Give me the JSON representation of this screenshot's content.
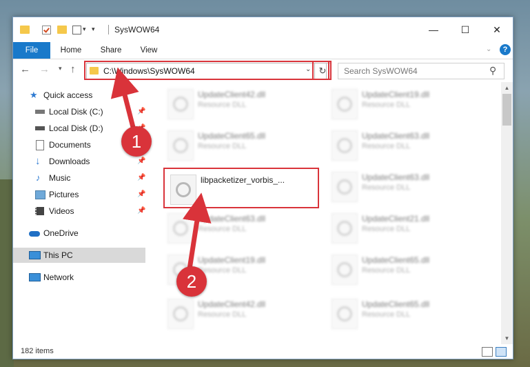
{
  "window": {
    "title": "SysWOW64"
  },
  "window_controls": {
    "minimize": "—",
    "maximize": "☐",
    "close": "✕"
  },
  "ribbon": {
    "tabs": [
      "File",
      "Home",
      "Share",
      "View"
    ]
  },
  "nav": {
    "address": "C:\\Windows\\SysWOW64",
    "search_placeholder": "Search SysWOW64"
  },
  "sidebar": {
    "items": [
      {
        "label": "Quick access",
        "icon": "star-icon"
      },
      {
        "label": "Local Disk (C:)",
        "icon": "drive-icon"
      },
      {
        "label": "Local Disk (D:)",
        "icon": "drive-icon"
      },
      {
        "label": "Documents",
        "icon": "documents-icon"
      },
      {
        "label": "Downloads",
        "icon": "download-icon"
      },
      {
        "label": "Music",
        "icon": "music-icon"
      },
      {
        "label": "Pictures",
        "icon": "pictures-icon"
      },
      {
        "label": "Videos",
        "icon": "videos-icon"
      },
      {
        "label": "OneDrive",
        "icon": "cloud-icon"
      },
      {
        "label": "This PC",
        "icon": "computer-icon"
      },
      {
        "label": "Network",
        "icon": "network-icon"
      }
    ]
  },
  "files": [
    {
      "name": "UpdateClient42.dll",
      "type": "Resource DLL"
    },
    {
      "name": "UpdateClient19.dll",
      "type": "Resource DLL"
    },
    {
      "name": "UpdateClient65.dll",
      "type": "Resource DLL"
    },
    {
      "name": "UpdateClient63.dll",
      "type": "Resource DLL"
    },
    {
      "name": "libpacketizer_vorbis_...",
      "type": ""
    },
    {
      "name": "UpdateClient63.dll",
      "type": "Resource DLL"
    },
    {
      "name": "UpdateClient63.dll",
      "type": "Resource DLL"
    },
    {
      "name": "UpdateClient21.dll",
      "type": "Resource DLL"
    },
    {
      "name": "UpdateClient19.dll",
      "type": "Resource DLL"
    },
    {
      "name": "UpdateClient65.dll",
      "type": "Resource DLL"
    },
    {
      "name": "UpdateClient42.dll",
      "type": "Resource DLL"
    },
    {
      "name": "UpdateClient65.dll",
      "type": "Resource DLL"
    }
  ],
  "status": {
    "count": "182 items"
  },
  "annotations": {
    "step1": "1",
    "step2": "2",
    "highlight_color": "#d9333a"
  },
  "colors": {
    "accent": "#1979ca",
    "folder": "#f5c84b"
  }
}
